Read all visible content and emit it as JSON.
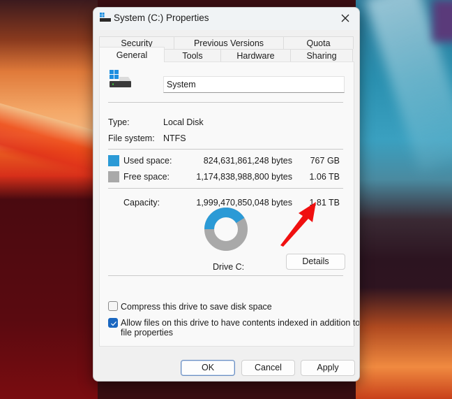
{
  "window": {
    "title": "System (C:) Properties",
    "close_icon": "close-icon"
  },
  "tabs": {
    "back_row": [
      {
        "label": "Security"
      },
      {
        "label": "Previous Versions"
      },
      {
        "label": "Quota"
      }
    ],
    "front_row": [
      {
        "label": "General",
        "active": true
      },
      {
        "label": "Tools"
      },
      {
        "label": "Hardware"
      },
      {
        "label": "Sharing"
      }
    ]
  },
  "general": {
    "drive_icon": "drive-icon",
    "name_value": "System",
    "type_label": "Type:",
    "type_value": "Local Disk",
    "fs_label": "File system:",
    "fs_value": "NTFS",
    "used": {
      "label": "Used space:",
      "bytes": "824,631,861,248 bytes",
      "size": "767 GB",
      "color": "#2b9ad6"
    },
    "free": {
      "label": "Free space:",
      "bytes": "1,174,838,988,800 bytes",
      "size": "1.06 TB",
      "color": "#a9a9a9"
    },
    "capacity": {
      "label": "Capacity:",
      "bytes": "1,999,470,850,048 bytes",
      "size": "1.81 TB"
    },
    "usage_fraction": 0.4124,
    "drive_label": "Drive C:",
    "details_button": "Details",
    "compress_label": "Compress this drive to save disk space",
    "compress_checked": false,
    "index_label_line1": "Allow files on this drive to have contents indexed in addition to",
    "index_label_line2": "file properties",
    "index_checked": true
  },
  "footer": {
    "ok": "OK",
    "cancel": "Cancel",
    "apply": "Apply"
  },
  "annotation": {
    "arrow_color": "#f01010",
    "points_to": "capacity-size"
  }
}
